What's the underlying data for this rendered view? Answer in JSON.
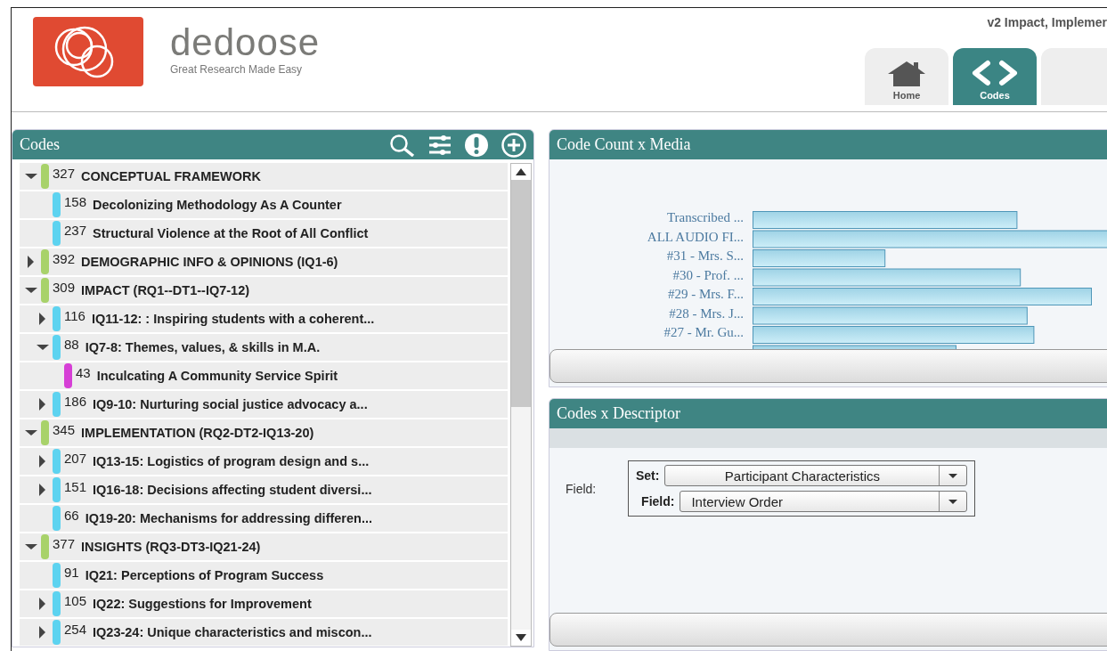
{
  "header": {
    "brand": "dedoose",
    "tagline": "Great Research Made Easy",
    "project_title": "v2 Impact, Implemer",
    "tabs": [
      {
        "label": "Home",
        "kind": "home",
        "selected": false
      },
      {
        "label": "Codes",
        "kind": "code",
        "selected": true
      }
    ]
  },
  "codes_panel": {
    "title": "Codes",
    "items": [
      {
        "count": "327",
        "label": "CONCEPTUAL FRAMEWORK",
        "color": "#a8d26a",
        "expanded": true,
        "children": [
          {
            "count": "158",
            "label": "Decolonizing Methodology As A Counter",
            "color": "#5dd3f0"
          },
          {
            "count": "237",
            "label": "Structural Violence at the Root of All Conflict",
            "color": "#5dd3f0"
          }
        ]
      },
      {
        "count": "392",
        "label": "DEMOGRAPHIC INFO & OPINIONS (IQ1-6)",
        "color": "#a8d26a",
        "expanded": false
      },
      {
        "count": "309",
        "label": "IMPACT (RQ1--DT1--IQ7-12)",
        "color": "#a8d26a",
        "expanded": true,
        "children": [
          {
            "count": "116",
            "label": "IQ11-12: : Inspiring students with a coherent...",
            "color": "#5dd3f0",
            "expanded": false
          },
          {
            "count": "88",
            "label": "IQ7-8: Themes, values, & skills in M.A.",
            "color": "#5dd3f0",
            "expanded": true,
            "children": [
              {
                "count": "43",
                "label": "Inculcating A Community Service Spirit",
                "color": "#d63fd6"
              }
            ]
          },
          {
            "count": "186",
            "label": "IQ9-10: Nurturing social justice advocacy a...",
            "color": "#5dd3f0",
            "expanded": false
          }
        ]
      },
      {
        "count": "345",
        "label": "IMPLEMENTATION (RQ2-DT2-IQ13-20)",
        "color": "#a8d26a",
        "expanded": true,
        "children": [
          {
            "count": "207",
            "label": "IQ13-15: Logistics of program design and s...",
            "color": "#5dd3f0",
            "expanded": false
          },
          {
            "count": "151",
            "label": "IQ16-18: Decisions affecting student diversi...",
            "color": "#5dd3f0",
            "expanded": false
          },
          {
            "count": "66",
            "label": "IQ19-20: Mechanisms for addressing differen...",
            "color": "#5dd3f0"
          }
        ]
      },
      {
        "count": "377",
        "label": "INSIGHTS (RQ3-DT3-IQ21-24)",
        "color": "#a8d26a",
        "expanded": true,
        "children": [
          {
            "count": "91",
            "label": "IQ21: Perceptions of Program Success",
            "color": "#5dd3f0"
          },
          {
            "count": "105",
            "label": "IQ22: Suggestions for Improvement",
            "color": "#5dd3f0",
            "expanded": false
          },
          {
            "count": "254",
            "label": "IQ23-24: Unique characteristics and miscon...",
            "color": "#5dd3f0",
            "expanded": false
          }
        ]
      }
    ]
  },
  "media_panel": {
    "title": "Code Count x Media",
    "bar_labels": [
      "Transcribed ...",
      "ALL AUDIO FI...",
      "#31 - Mrs. S...",
      "#30 - Prof. ...",
      "#29 - Mrs. F...",
      "#28 - Mrs. J...",
      "#27 - Mr. Gu..."
    ]
  },
  "descriptor_panel": {
    "title": "Codes x Descriptor",
    "field_label": "Field:",
    "selects": [
      {
        "label": "Set:",
        "value": "Participant Characteristics"
      },
      {
        "label": "Field:",
        "value": "Interview Order"
      }
    ]
  }
}
